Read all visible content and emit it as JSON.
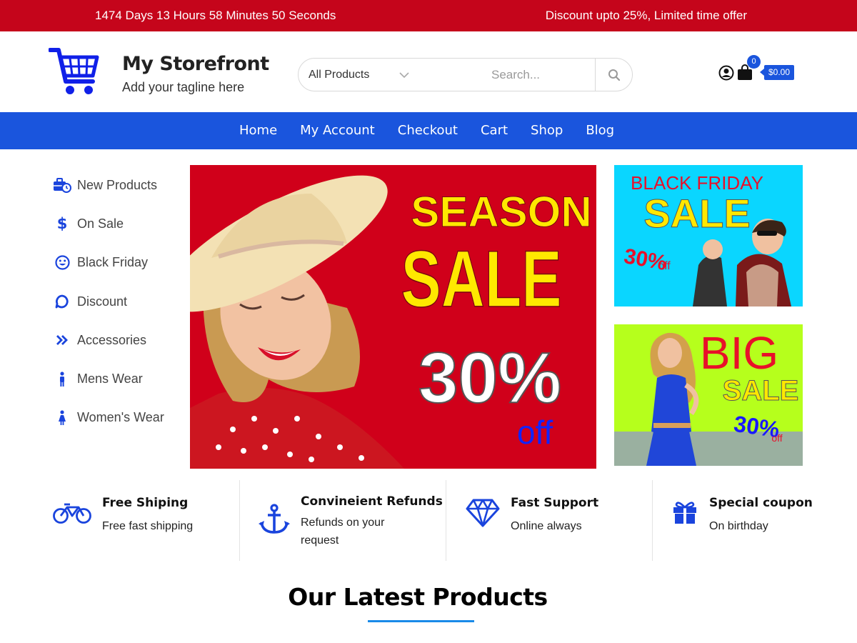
{
  "topbar": {
    "countdown": "1474 Days 13 Hours 58 Minutes 50 Seconds",
    "offer": "Discount upto 25%, Limited time offer"
  },
  "header": {
    "logo_icon": "cart-icon",
    "title": "My Storefront",
    "tagline": "Add your tagline here",
    "search": {
      "category": "All Products",
      "placeholder": "Search...",
      "button_icon": "search-icon"
    },
    "account_icon": "user-icon",
    "cart": {
      "icon": "bag-icon",
      "count": "0",
      "total": "$0.00"
    }
  },
  "nav": {
    "items": [
      "Home",
      "My Account",
      "Checkout",
      "Cart",
      "Shop",
      "Blog"
    ]
  },
  "sidebar": {
    "items": [
      {
        "label": "New Products",
        "icon": "briefcase-clock-icon"
      },
      {
        "label": "On Sale",
        "icon": "dollar-icon"
      },
      {
        "label": "Black Friday",
        "icon": "smile-icon"
      },
      {
        "label": "Discount",
        "icon": "chat-bubble-icon"
      },
      {
        "label": "Accessories",
        "icon": "double-chevron-right-icon"
      },
      {
        "label": "Mens Wear",
        "icon": "male-icon"
      },
      {
        "label": "Women's Wear",
        "icon": "female-icon"
      }
    ]
  },
  "hero": {
    "line1": "SEASON",
    "line2": "SALE",
    "percent": "30%",
    "off": "off"
  },
  "promo1": {
    "line1": "BLACK FRIDAY",
    "line2": "SALE",
    "percent": "30%",
    "off": "off"
  },
  "promo2": {
    "line1": "BIG",
    "line2": "SALE",
    "percent": "30%",
    "off": "off"
  },
  "features": [
    {
      "title": "Free Shiping",
      "subtitle": "Free fast shipping",
      "icon": "bicycle-icon"
    },
    {
      "title": "Convineient Refunds",
      "subtitle": "Refunds on your request",
      "icon": "anchor-icon"
    },
    {
      "title": "Fast Support",
      "subtitle": "Online always",
      "icon": "diamond-icon"
    },
    {
      "title": "Special coupon",
      "subtitle": "On birthday",
      "icon": "gift-icon"
    }
  ],
  "section": {
    "title": "Our Latest Products"
  },
  "colors": {
    "topbar": "#c5051b",
    "primary": "#1a55dd",
    "accent_underline": "#1a8ae8"
  }
}
